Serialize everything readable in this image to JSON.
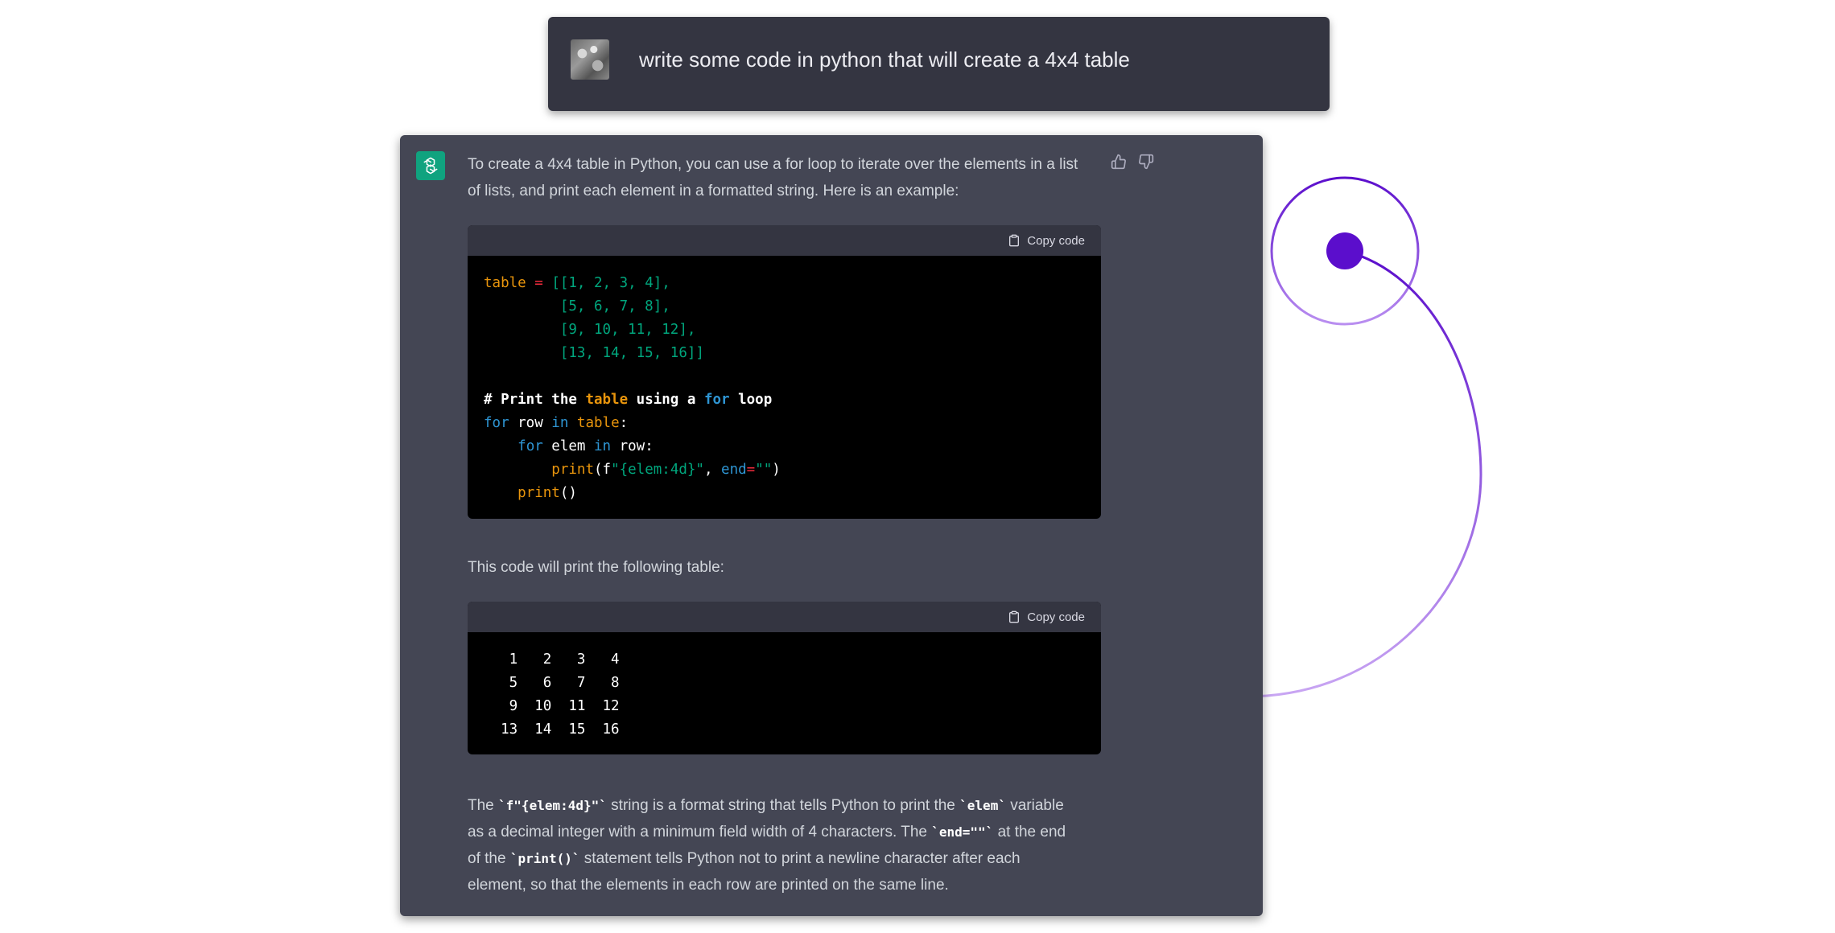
{
  "user_message": {
    "text": "write some code in python that will create a 4x4 table"
  },
  "assistant_message": {
    "intro_line1": "To create a 4x4 table in Python, you can use a for loop to iterate over the elements in a list",
    "intro_line2": "of lists, and print each element in a formatted string. Here is an example:",
    "copy_label": "Copy code",
    "middle_text": "This code will print the following table:",
    "output_rows": [
      "   1   2   3   4",
      "   5   6   7   8",
      "   9  10  11  12",
      "  13  14  15  16"
    ],
    "outro": {
      "p1": "The ",
      "code1": "`f\"{elem:4d}\"`",
      "p2": " string is a format string that tells Python to print the ",
      "code2": "`elem`",
      "p3": " variable",
      "p4": "as a decimal integer with a minimum field width of 4 characters. The ",
      "code3": "`end=\"\"`",
      "p5": " at the end",
      "p6": "of the ",
      "code4": "`print()`",
      "p7": " statement tells Python not to print a newline character after each",
      "p8": "element, so that the elements in each row are printed on the same line."
    }
  },
  "icons": [
    "openai-logo-icon",
    "thumbs-up-icon",
    "thumbs-down-icon",
    "clipboard-icon"
  ],
  "colors": {
    "user_bg": "#343541",
    "assistant_bg": "#444654",
    "accent_green": "#10a37f",
    "decoration_purple": "#5b0ecc"
  }
}
